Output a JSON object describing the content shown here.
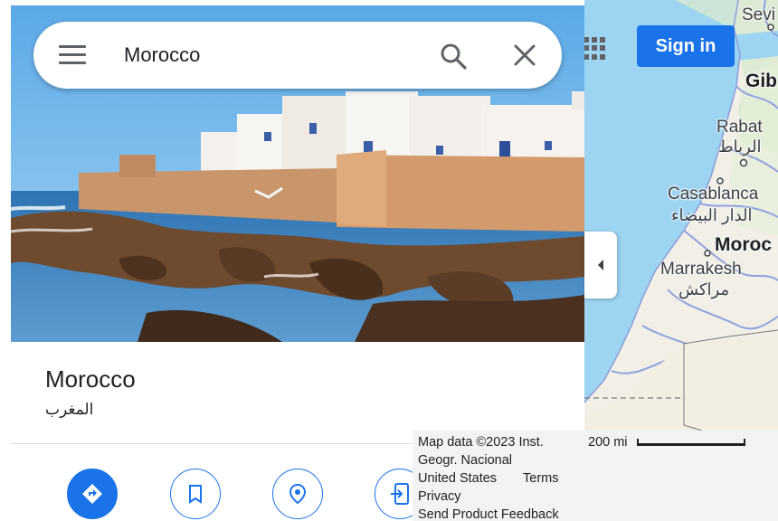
{
  "search": {
    "query": "Morocco"
  },
  "header": {
    "sign_in_label": "Sign in"
  },
  "place": {
    "name": "Morocco",
    "native_name": "المغرب"
  },
  "map": {
    "labels": {
      "sevilla_partial": "Sevi",
      "gibraltar_partial": "Gib",
      "rabat": "Rabat",
      "rabat_ar": "الرباط",
      "casablanca": "Casablanca",
      "casablanca_ar": "الدار البيضاء",
      "morocco_partial": "Moroc",
      "marrakesh": "Marrakesh",
      "marrakesh_ar": "مراكش"
    }
  },
  "footer": {
    "attribution_line1": "Map data ©2023 Inst.",
    "attribution_line2": "Geogr. Nacional",
    "region": "United States",
    "terms": "Terms",
    "privacy": "Privacy",
    "feedback": "Send Product Feedback",
    "scale": "200 mi"
  },
  "colors": {
    "accent": "#1a73e8",
    "water": "#9cd4f2",
    "land": "#f1efe6",
    "land_green": "#cfe6c4",
    "border": "#6f87d6"
  },
  "icons": {
    "menu": "menu-icon",
    "search": "search-icon",
    "close": "close-icon",
    "apps": "apps-grid-icon",
    "collapse": "chevron-left-icon",
    "directions": "directions-icon",
    "save": "bookmark-icon",
    "nearby": "nearby-icon",
    "share": "send-to-phone-icon"
  }
}
